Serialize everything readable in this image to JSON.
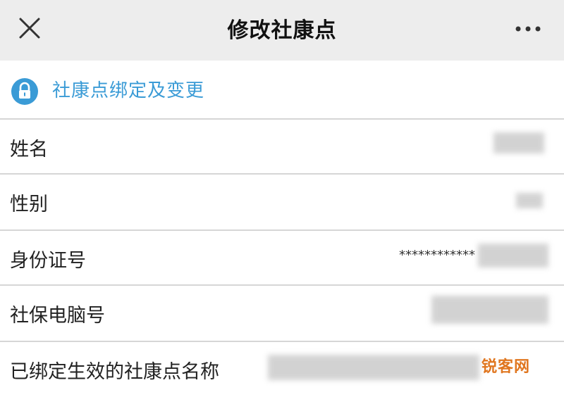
{
  "header": {
    "title": "修改社康点",
    "close_icon": "close-icon",
    "more_icon": "more-horizontal-icon"
  },
  "section": {
    "icon": "lock-icon",
    "title": "社康点绑定及变更",
    "accent_color": "#3a9bd6"
  },
  "rows": [
    {
      "label": "姓名",
      "value": ""
    },
    {
      "label": "性别",
      "value": ""
    },
    {
      "label": "身份证号",
      "value": "************"
    },
    {
      "label": "社保电脑号",
      "value": ""
    },
    {
      "label": "已绑定生效的社康点名称",
      "value": ""
    }
  ],
  "watermark": "锐客网"
}
